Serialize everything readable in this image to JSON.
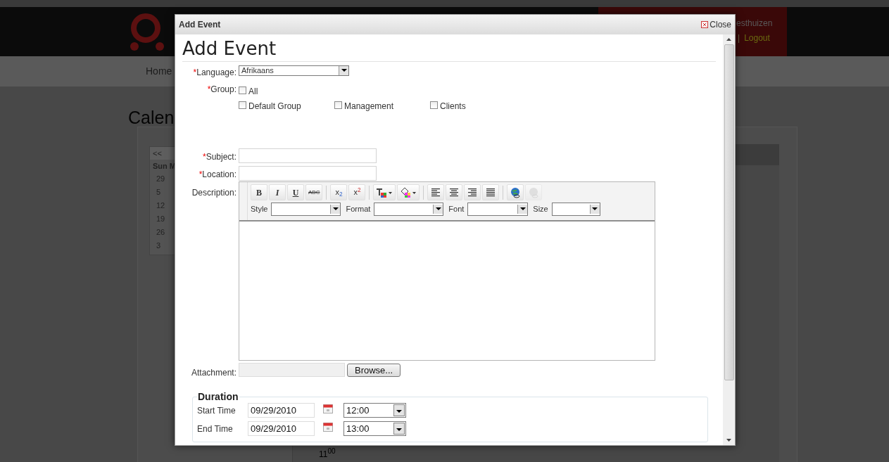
{
  "background": {
    "nav": [
      "Home"
    ],
    "page_title": "Calen",
    "user": "esthuizen",
    "separator": "|",
    "logout": "Logout",
    "calendar": {
      "prev": "<<",
      "weekdays": [
        "Sun",
        "M"
      ],
      "days": [
        "29",
        "5",
        "12",
        "19",
        "26",
        "3"
      ]
    },
    "time_label": {
      "hour": "11",
      "minutes": "00"
    }
  },
  "dialog": {
    "title": "Add Event",
    "close": "Close",
    "heading": "Add Event",
    "language": {
      "mark": "*",
      "label": "Language:",
      "value": "Afrikaans"
    },
    "group": {
      "mark": "*",
      "label": "Group:",
      "options": [
        {
          "label": "All",
          "checked": false
        },
        {
          "label": "Default Group",
          "checked": false
        },
        {
          "label": "Management",
          "checked": false
        },
        {
          "label": "Clients",
          "checked": false
        }
      ]
    },
    "subject": {
      "mark": "*",
      "label": "Subject:"
    },
    "location": {
      "mark": "*",
      "label": "Location:"
    },
    "description": {
      "label": "Description:",
      "tool_groups": [
        [
          {
            "kind": "bold",
            "label": "B",
            "disabled": false
          },
          {
            "kind": "italic",
            "label": "I",
            "disabled": false
          },
          {
            "kind": "underline",
            "label": "U",
            "disabled": false
          },
          {
            "kind": "strike",
            "label": "ABC",
            "disabled": false
          }
        ],
        [
          {
            "kind": "sub",
            "label": "x$_{2}$",
            "disabled": false
          },
          {
            "kind": "sup",
            "label": "x$^{2}$",
            "disabled": false
          }
        ],
        [
          {
            "kind": "textcolor",
            "disabled": false
          },
          {
            "kind": "bgcolor",
            "disabled": false
          }
        ],
        [
          {
            "kind": "left",
            "disabled": false
          },
          {
            "kind": "center",
            "disabled": false
          },
          {
            "kind": "right",
            "disabled": false
          },
          {
            "kind": "justify",
            "disabled": false
          }
        ],
        [
          {
            "kind": "link",
            "disabled": false
          },
          {
            "kind": "unlink",
            "disabled": true
          }
        ]
      ],
      "dropdowns": [
        {
          "label": "Style"
        },
        {
          "label": "Format"
        },
        {
          "label": "Font"
        },
        {
          "label": "Size"
        }
      ]
    },
    "attachment": {
      "label": "Attachment:",
      "button": "Browse..."
    },
    "duration": {
      "legend": "Duration",
      "rows": [
        {
          "label": "Start Time",
          "date": "09/29/2010",
          "time": "12:00"
        },
        {
          "label": "End Time",
          "date": "09/29/2010",
          "time": "13:00"
        }
      ]
    }
  }
}
